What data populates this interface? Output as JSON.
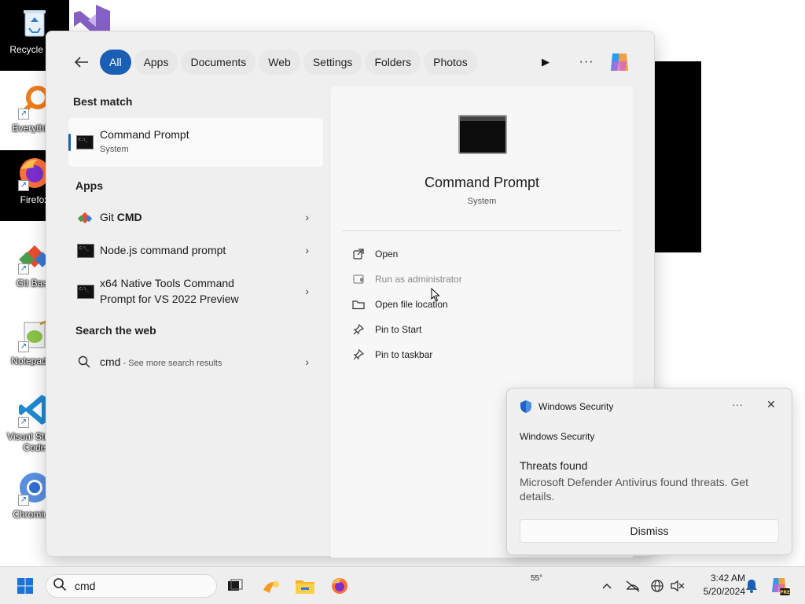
{
  "desktop": {
    "icons": [
      {
        "label": "Recycle Bin"
      },
      {
        "label": "Everything"
      },
      {
        "label": "Firefox"
      },
      {
        "label": "Git Bash"
      },
      {
        "label": "Notepad++"
      },
      {
        "label": "Visual Studio Code"
      },
      {
        "label": "Chromium"
      }
    ]
  },
  "search_panel": {
    "filters": [
      "All",
      "Apps",
      "Documents",
      "Web",
      "Settings",
      "Folders",
      "Photos"
    ],
    "active_filter": "All",
    "best_match": {
      "header": "Best match",
      "title": "Command Prompt",
      "subtitle": "System"
    },
    "apps": {
      "header": "Apps",
      "items": [
        {
          "prefix": "Git ",
          "bold": "CMD"
        },
        {
          "label": "Node.js command prompt"
        },
        {
          "line1": "x64 Native Tools Command",
          "line2": "Prompt for VS 2022 Preview"
        }
      ]
    },
    "web": {
      "header": "Search the web",
      "query": "cmd",
      "hint": " - See more search results"
    },
    "preview": {
      "title": "Command Prompt",
      "subtitle": "System",
      "actions": [
        {
          "label": "Open",
          "icon": "open-external-icon",
          "disabled": false
        },
        {
          "label": "Run as administrator",
          "icon": "shield-admin-icon",
          "disabled": true
        },
        {
          "label": "Open file location",
          "icon": "folder-icon",
          "disabled": false
        },
        {
          "label": "Pin to Start",
          "icon": "pin-icon",
          "disabled": false
        },
        {
          "label": "Pin to taskbar",
          "icon": "pin-icon",
          "disabled": false
        }
      ]
    }
  },
  "notification": {
    "app_name": "Windows Security",
    "source": "Windows Security",
    "title": "Threats found",
    "body": "Microsoft Defender Antivirus found threats. Get details.",
    "dismiss_label": "Dismiss"
  },
  "taskbar": {
    "search_value": "cmd",
    "weather_temp": "55°",
    "clock_time": "3:42 AM",
    "clock_date": "5/20/2024",
    "copilot_badge": "PRE"
  },
  "colors": {
    "accent": "#1a5fb4",
    "panel_bg": "#efefef",
    "taskbar_bg": "#eeeeee"
  }
}
